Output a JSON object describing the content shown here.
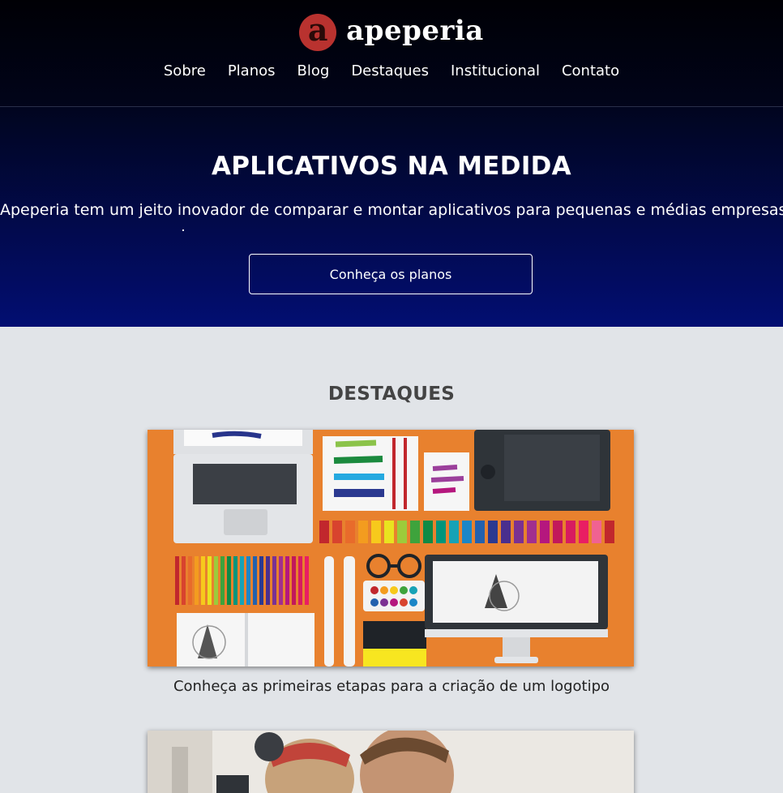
{
  "brand": {
    "logo_letter": "a",
    "name": "apeperia",
    "logo_color": "#b9322f"
  },
  "nav": [
    "Sobre",
    "Planos",
    "Blog",
    "Destaques",
    "Institucional",
    "Contato"
  ],
  "hero": {
    "title": "APLICATIVOS NA MEDIDA",
    "subtitle": "Apeperia tem um jeito inovador de comparar e montar aplicativos para pequenas e médias empresas.",
    "cta_label": "Conheça os planos"
  },
  "featured": {
    "heading": "DESTAQUES",
    "items": [
      {
        "caption": "Conheça as primeiras etapas para a criação de um logotipo",
        "image": "design-tools-flatlay-illustration"
      },
      {
        "caption": "",
        "image": "people-photo"
      }
    ]
  },
  "colors": {
    "header_bg": "#000005",
    "hero_bg_bottom": "#020e72",
    "page_bg": "#e1e4e8",
    "card_orange": "#e8812e"
  }
}
